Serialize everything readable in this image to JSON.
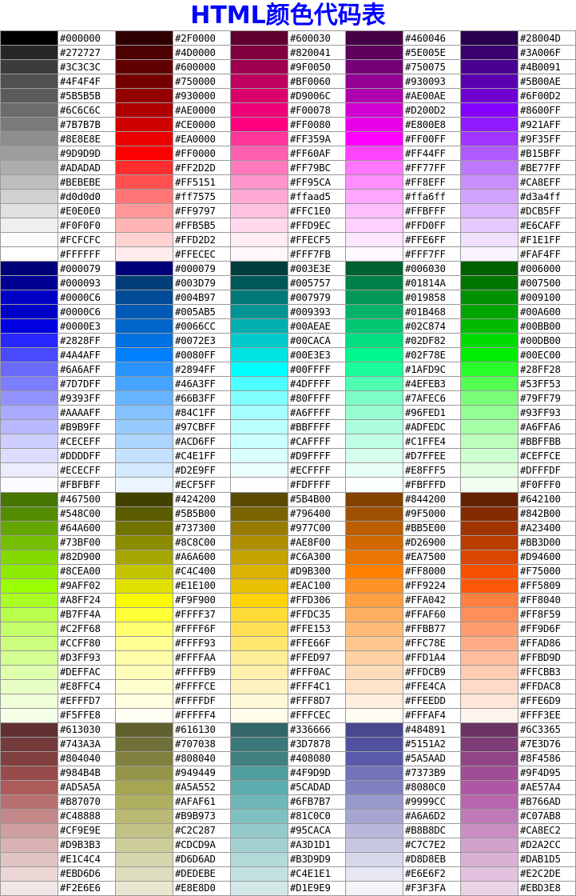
{
  "title": "HTML颜色代码表",
  "blocks": [
    {
      "columns": [
        [
          "#000000",
          "#272727",
          "#3C3C3C",
          "#4F4F4F",
          "#5B5B5B",
          "#6C6C6C",
          "#7B7B7B",
          "#8E8E8E",
          "#9D9D9D",
          "#ADADAD",
          "#BEBEBE",
          "#d0d0d0",
          "#E0E0E0",
          "#F0F0F0",
          "#FCFCFC",
          "#FFFFFF"
        ],
        [
          "#2F0000",
          "#4D0000",
          "#600000",
          "#750000",
          "#930000",
          "#AE0000",
          "#CE0000",
          "#EA0000",
          "#FF0000",
          "#FF2D2D",
          "#FF5151",
          "#ff7575",
          "#FF9797",
          "#FFB5B5",
          "#FFD2D2",
          "#FFECEC"
        ],
        [
          "#600030",
          "#820041",
          "#9F0050",
          "#BF0060",
          "#D9006C",
          "#F00078",
          "#FF0080",
          "#FF359A",
          "#FF60AF",
          "#FF79BC",
          "#FF95CA",
          "#ffaad5",
          "#FFC1E0",
          "#FFD9EC",
          "#FFECF5",
          "#FFF7FB"
        ],
        [
          "#460046",
          "#5E005E",
          "#750075",
          "#930093",
          "#AE00AE",
          "#D200D2",
          "#E800E8",
          "#FF00FF",
          "#FF44FF",
          "#FF77FF",
          "#FF8EFF",
          "#ffa6ff",
          "#FFBFFF",
          "#FFD0FF",
          "#FFE6FF",
          "#FFF7FF"
        ],
        [
          "#28004D",
          "#3A006F",
          "#4B0091",
          "#5B00AE",
          "#6F00D2",
          "#8600FF",
          "#921AFF",
          "#9F35FF",
          "#B15BFF",
          "#BE77FF",
          "#CA8EFF",
          "#d3a4ff",
          "#DCB5FF",
          "#E6CAFF",
          "#F1E1FF",
          "#FAF4FF"
        ]
      ]
    },
    {
      "columns": [
        [
          "#000079",
          "#000093",
          "#0000C6",
          "#0000C6",
          "#0000E3",
          "#2828FF",
          "#4A4AFF",
          "#6A6AFF",
          "#7D7DFF",
          "#9393FF",
          "#AAAAFF",
          "#B9B9FF",
          "#CECEFF",
          "#DDDDFF",
          "#ECECFF",
          "#FBFBFF"
        ],
        [
          "#000079",
          "#003D79",
          "#004B97",
          "#005AB5",
          "#0066CC",
          "#0072E3",
          "#0080FF",
          "#2894FF",
          "#46A3FF",
          "#66B3FF",
          "#84C1FF",
          "#97CBFF",
          "#ACD6FF",
          "#C4E1FF",
          "#D2E9FF",
          "#ECF5FF"
        ],
        [
          "#003E3E",
          "#005757",
          "#007979",
          "#009393",
          "#00AEAE",
          "#00CACA",
          "#00E3E3",
          "#00FFFF",
          "#4DFFFF",
          "#80FFFF",
          "#A6FFFF",
          "#BBFFFF",
          "#CAFFFF",
          "#D9FFFF",
          "#ECFFFF",
          "#FDFFFF"
        ],
        [
          "#006030",
          "#01814A",
          "#019858",
          "#01B468",
          "#02C874",
          "#02DF82",
          "#02F78E",
          "#1AFD9C",
          "#4EFEB3",
          "#7AFEC6",
          "#96FED1",
          "#ADFEDC",
          "#C1FFE4",
          "#D7FFEE",
          "#E8FFF5",
          "#FBFFFD"
        ],
        [
          "#006000",
          "#007500",
          "#009100",
          "#00A600",
          "#00BB00",
          "#00DB00",
          "#00EC00",
          "#28FF28",
          "#53FF53",
          "#79FF79",
          "#93FF93",
          "#A6FFA6",
          "#BBFFBB",
          "#CEFFCE",
          "#DFFFDF",
          "#F0FFF0"
        ]
      ]
    },
    {
      "columns": [
        [
          "#467500",
          "#548C00",
          "#64A600",
          "#73BF00",
          "#82D900",
          "#8CEA00",
          "#9AFF02",
          "#A8FF24",
          "#B7FF4A",
          "#C2FF68",
          "#CCFF80",
          "#D3FF93",
          "#DEFFAC",
          "#E8FFC4",
          "#EFFFD7",
          "#F5FFE8"
        ],
        [
          "#424200",
          "#5B5B00",
          "#737300",
          "#8C8C00",
          "#A6A600",
          "#C4C400",
          "#E1E100",
          "#F9F900",
          "#FFFF37",
          "#FFFF6F",
          "#FFFF93",
          "#FFFFAA",
          "#FFFFB9",
          "#FFFFCE",
          "#FFFFDF",
          "#FFFFF4"
        ],
        [
          "#5B4B00",
          "#796400",
          "#977C00",
          "#AE8F00",
          "#C6A300",
          "#D9B300",
          "#EAC100",
          "#FFD306",
          "#FFDC35",
          "#FFE153",
          "#FFE66F",
          "#FFED97",
          "#FFF0AC",
          "#FFF4C1",
          "#FFF8D7",
          "#FFFCEC"
        ],
        [
          "#844200",
          "#9F5000",
          "#BB5E00",
          "#D26900",
          "#EA7500",
          "#FF8000",
          "#FF9224",
          "#FFA042",
          "#FFAF60",
          "#FFBB77",
          "#FFC78E",
          "#FFD1A4",
          "#FFDCB9",
          "#FFE4CA",
          "#FFEEDD",
          "#FFFAF4"
        ],
        [
          "#642100",
          "#842B00",
          "#A23400",
          "#BB3D00",
          "#D94600",
          "#F75000",
          "#FF5809",
          "#FF8040",
          "#FF8F59",
          "#FF9D6F",
          "#FFAD86",
          "#FFBD9D",
          "#FFCBB3",
          "#FFDAC8",
          "#FFE6D9",
          "#FFF3EE"
        ]
      ]
    },
    {
      "columns": [
        [
          "#613030",
          "#743A3A",
          "#804040",
          "#984B4B",
          "#AD5A5A",
          "#B87070",
          "#C48888",
          "#CF9E9E",
          "#D9B3B3",
          "#E1C4C4",
          "#EBD6D6",
          "#F2E6E6"
        ],
        [
          "#616130",
          "#707038",
          "#808040",
          "#949449",
          "#A5A552",
          "#AFAF61",
          "#B9B973",
          "#C2C287",
          "#CDCD9A",
          "#D6D6AD",
          "#DEDEBE",
          "#E8E8D0"
        ],
        [
          "#336666",
          "#3D7878",
          "#408080",
          "#4F9D9D",
          "#5CADAD",
          "#6FB7B7",
          "#81C0C0",
          "#95CACA",
          "#A3D1D1",
          "#B3D9D9",
          "#C4E1E1",
          "#D1E9E9"
        ],
        [
          "#484891",
          "#5151A2",
          "#5A5AAD",
          "#7373B9",
          "#8080C0",
          "#9999CC",
          "#A6A6D2",
          "#B8B8DC",
          "#C7C7E2",
          "#D8D8EB",
          "#E6E6F2",
          "#F3F3FA"
        ],
        [
          "#6C3365",
          "#7E3D76",
          "#8F4586",
          "#9F4D95",
          "#AE57A4",
          "#B766AD",
          "#C07AB8",
          "#CA8EC2",
          "#D2A2CC",
          "#DAB1D5",
          "#E2C2DE",
          "#EBD3E8"
        ]
      ]
    }
  ]
}
